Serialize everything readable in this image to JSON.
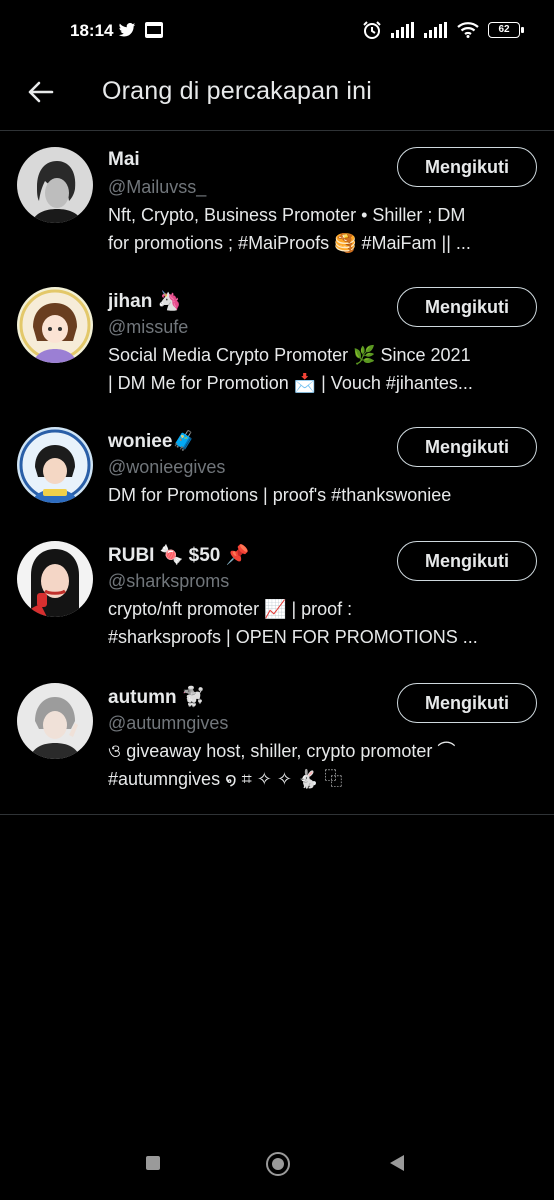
{
  "status_bar": {
    "time": "18:14",
    "battery": "62"
  },
  "header": {
    "title": "Orang di percakapan ini"
  },
  "follow_label": "Mengikuti",
  "users": [
    {
      "name": "Mai",
      "handle": "@Mailuvss_",
      "bio_line1": "Nft, Crypto, Business Promoter • Shiller ; DM",
      "bio_line2": "for promotions ; #MaiProofs 🥞 #MaiFam || ..."
    },
    {
      "name": "jihan 🦄",
      "handle": "@missufe",
      "bio_line1": "Social Media Crypto Promoter 🌿 Since 2021",
      "bio_line2": "| DM Me for Promotion 📩 | Vouch #jihantes..."
    },
    {
      "name": "woniee🧳",
      "handle": "@wonieegives",
      "bio_line1": "DM for Promotions | proof's #thankswoniee",
      "bio_line2": ""
    },
    {
      "name": "RUBI 🍬 $50 📌",
      "handle": "@sharksproms",
      "bio_line1": "crypto/nft promoter 📈 | proof :",
      "bio_line2": "#sharksproofs  | OPEN FOR PROMOTIONS ..."
    },
    {
      "name": "autumn 🐩",
      "handle": "@autumngives",
      "bio_line1": "ও giveaway host, shiller, crypto promoter ⌒",
      "bio_line2": "#autumngives ໑ ⌗ ✧ ✧ 🐇 ⿻"
    }
  ]
}
